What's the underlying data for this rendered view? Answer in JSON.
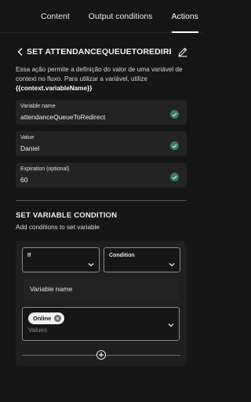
{
  "tabs": [
    {
      "label": "Content"
    },
    {
      "label": "Output conditions"
    },
    {
      "label": "Actions"
    }
  ],
  "header": {
    "title": "SET ATTENDANCEQUEUETOREDIRECT IF N"
  },
  "description": {
    "text": "Essa ação permite a definição do valor de uma variável de context no fluxo. Para utilizar a variável, utilize ",
    "code": "{{context.variableName}}"
  },
  "fields": {
    "variable_name": {
      "label": "Variable name",
      "value": "attendanceQueueToRedirect"
    },
    "value": {
      "label": "Value",
      "value": "Daniel"
    },
    "expiration": {
      "label": "Expiration (optional)",
      "value": "60"
    }
  },
  "condition_section": {
    "title": "SET VARIABLE CONDITION",
    "subtitle": "Add conditions to set variable",
    "if_select": {
      "label": "If"
    },
    "condition_select": {
      "label": "Condition"
    },
    "variable_name_input": {
      "placeholder": "Variable name"
    },
    "values": {
      "chips": [
        "Online"
      ],
      "placeholder": "Values"
    }
  },
  "colors": {
    "accent_check": "#3a7d5c",
    "background": "#161616",
    "field_bg": "#232323"
  }
}
